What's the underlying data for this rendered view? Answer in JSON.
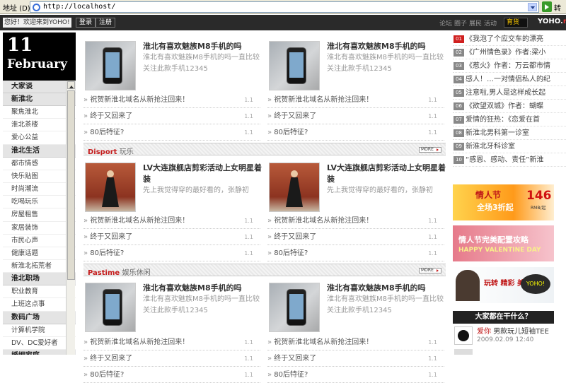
{
  "browser": {
    "address_label": "地址 (D)",
    "url": "http://localhost/",
    "go_label": "转到"
  },
  "topbar": {
    "welcome": "您好！欢迎来到YOHO!",
    "login": "登录",
    "register": "注册",
    "links": [
      "论坛",
      "圈子",
      "展民",
      "活动"
    ],
    "shop": "育货",
    "logo": "YOHO.",
    "logo_suffix": "r"
  },
  "date": {
    "day": "11",
    "month": "February"
  },
  "nav": [
    {
      "type": "sec",
      "label": "大家谈"
    },
    {
      "type": "sec",
      "label": "新淮北"
    },
    {
      "type": "item",
      "label": "聚焦淮北"
    },
    {
      "type": "item",
      "label": "淮北茶楼"
    },
    {
      "type": "item",
      "label": "爱心公益"
    },
    {
      "type": "sec",
      "label": "淮北生活"
    },
    {
      "type": "item",
      "label": "都市情感"
    },
    {
      "type": "item",
      "label": "快乐贴图"
    },
    {
      "type": "item",
      "label": "时尚潮流"
    },
    {
      "type": "item",
      "label": "吃喝玩乐"
    },
    {
      "type": "item",
      "label": "房屋租售"
    },
    {
      "type": "item",
      "label": "家居装饰"
    },
    {
      "type": "item",
      "label": "市民心声"
    },
    {
      "type": "item",
      "label": "健康话题"
    },
    {
      "type": "item",
      "label": "新淮北拓荒者"
    },
    {
      "type": "sec",
      "label": "淮北职场"
    },
    {
      "type": "item",
      "label": "职业教育"
    },
    {
      "type": "item",
      "label": "上班这点事"
    },
    {
      "type": "sec",
      "label": "数码广场"
    },
    {
      "type": "item",
      "label": "计算机学院"
    },
    {
      "type": "item",
      "label": "DV、DC爱好者"
    },
    {
      "type": "sec",
      "label": "婚姻家庭"
    }
  ],
  "main": {
    "phone_article": {
      "title": "淮北有喜欢魅族M8手机的吗",
      "summary": "淮北有喜欢魅族M8手机的吗一直比较关注此款手机12345"
    },
    "dress_article": {
      "title": "LV大连旗舰店剪彩活动上女明星着装",
      "summary": "先上我觉得穿的最好看的，张静初"
    },
    "links": [
      "祝贺新淮北域名从新抢注回来！",
      "终于又回来了",
      "80后特征?"
    ],
    "link_count": "1.1",
    "sections": [
      {
        "en": "Disport",
        "cn": "玩乐"
      },
      {
        "en": "Pastime",
        "cn": "娱乐休闲"
      }
    ],
    "more": "MORE"
  },
  "rank": [
    {
      "num": "01",
      "text": "《我泡了个应交车的漂亮"
    },
    {
      "num": "02",
      "text": "《广州情色录》作者:梁小"
    },
    {
      "num": "03",
      "text": "《惹火》作者：万云都市情"
    },
    {
      "num": "04",
      "text": "感人！…一对情侣私人的纪"
    },
    {
      "num": "05",
      "text": "注意啦,男人是这样成长起"
    },
    {
      "num": "06",
      "text": "《欲望双城》作者：蝴蝶"
    },
    {
      "num": "07",
      "text": "爱情的狂热：《恋爱在首"
    },
    {
      "num": "08",
      "text": "新淮北男科第一诊室"
    },
    {
      "num": "09",
      "text": "新淮北牙科诊室"
    },
    {
      "num": "10",
      "text": "“感恩、感动、责任”新淮"
    }
  ],
  "banners": {
    "b1_title": "情人节",
    "b1_sub": "全场3折起",
    "b1_num": "146",
    "b1_unit": "RMB/起",
    "b2_title": "情人节完美配置攻略",
    "b2_sub": "HAPPY VALENTINE DAY",
    "b3_title": "玩转 精彩 美学",
    "b3_logo": "YOHO!"
  },
  "ask_title": "大家都在干什么？",
  "user": {
    "name": "爱你",
    "action": "男款玩儿短袖TEE",
    "time": "2009.02.09 12:40"
  },
  "colors": {
    "accent_red": "#c41c1c",
    "topbar_bg": "#2a2a2a"
  }
}
